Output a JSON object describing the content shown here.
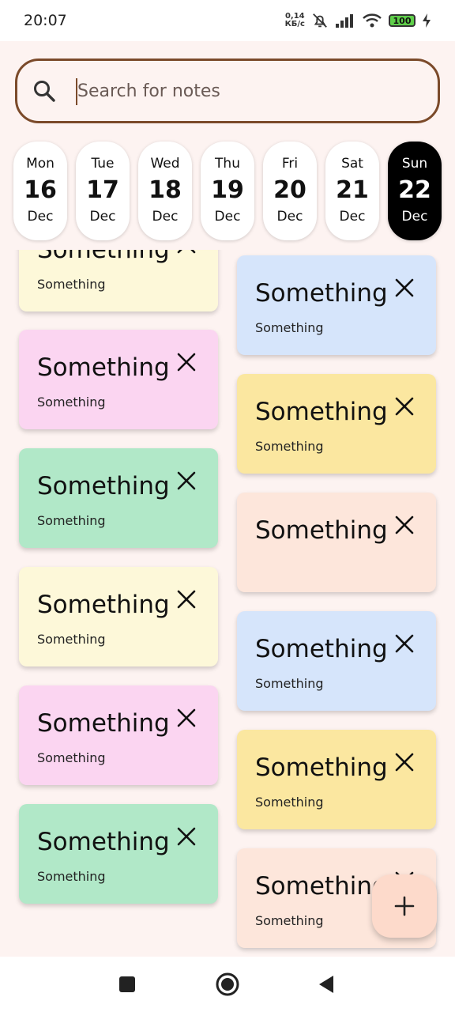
{
  "status_bar": {
    "time": "20:07",
    "net_speed_value": "0,14",
    "net_speed_unit": "КБ/с",
    "battery": "100",
    "icons": [
      "bell-muted-icon",
      "signal-icon",
      "wifi-icon",
      "battery-icon",
      "charging-icon"
    ]
  },
  "search": {
    "placeholder": "Search for notes",
    "value": ""
  },
  "dates": [
    {
      "day": "Mon",
      "num": "16",
      "month": "Dec",
      "selected": false
    },
    {
      "day": "Tue",
      "num": "17",
      "month": "Dec",
      "selected": false
    },
    {
      "day": "Wed",
      "num": "18",
      "month": "Dec",
      "selected": false
    },
    {
      "day": "Thu",
      "num": "19",
      "month": "Dec",
      "selected": false
    },
    {
      "day": "Fri",
      "num": "20",
      "month": "Dec",
      "selected": false
    },
    {
      "day": "Sat",
      "num": "21",
      "month": "Dec",
      "selected": false
    },
    {
      "day": "Sun",
      "num": "22",
      "month": "Dec",
      "selected": true
    }
  ],
  "colors": {
    "yellow_light": "#fdf8d9",
    "pink": "#fbd5f1",
    "green": "#b1e8c8",
    "blue": "#d6e5fb",
    "yellow": "#fbe7a0",
    "peach": "#fde6db",
    "background": "#fdf3f1",
    "accent_border": "#7b4a2a",
    "fab": "#fddacb"
  },
  "notes": {
    "left": [
      {
        "title": "Something",
        "body": "Something",
        "color": "#fdf8d9"
      },
      {
        "title": "Something",
        "body": "Something",
        "color": "#fbd5f1"
      },
      {
        "title": "Something",
        "body": "Something",
        "color": "#b1e8c8"
      },
      {
        "title": "Something",
        "body": "Something",
        "color": "#fdf8d9"
      },
      {
        "title": "Something",
        "body": "Something",
        "color": "#fbd5f1"
      },
      {
        "title": "Something",
        "body": "Something",
        "color": "#b1e8c8"
      }
    ],
    "right": [
      {
        "title": "Something",
        "body": "Something",
        "color": "#d6e5fb"
      },
      {
        "title": "Something",
        "body": "Something",
        "color": "#fbe7a0"
      },
      {
        "title": "Something",
        "body": "",
        "color": "#fde6db"
      },
      {
        "title": "Something",
        "body": "Something",
        "color": "#d6e5fb"
      },
      {
        "title": "Something",
        "body": "Something",
        "color": "#fbe7a0"
      },
      {
        "title": "Something",
        "body": "Something",
        "color": "#fde6db"
      }
    ]
  },
  "fab": {
    "icon": "plus-icon"
  },
  "nav": {
    "icons": [
      "recents-square-icon",
      "home-circle-icon",
      "back-triangle-icon"
    ]
  }
}
